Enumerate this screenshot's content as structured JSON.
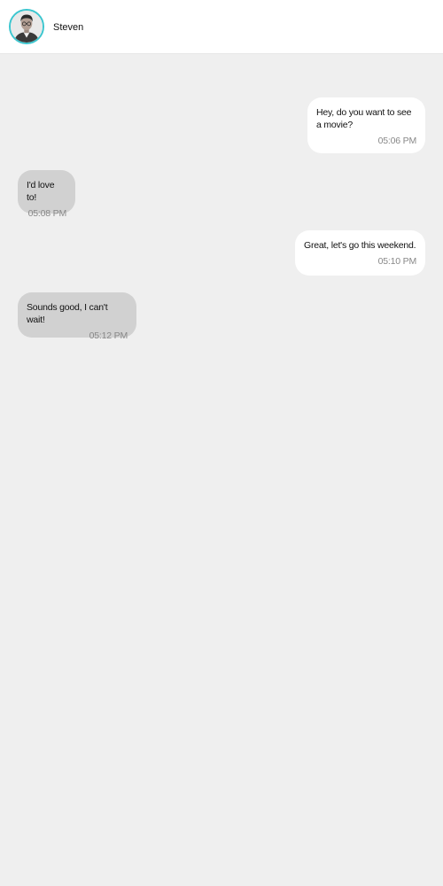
{
  "header": {
    "contact_name": "Steven"
  },
  "messages": [
    {
      "direction": "sent",
      "text": "Hey, do you want to see a movie?",
      "time": "05:06 PM"
    },
    {
      "direction": "received",
      "text": "I'd love to!",
      "time": "05:08 PM"
    },
    {
      "direction": "sent",
      "text": "Great, let's go this weekend.",
      "time": "05:10 PM"
    },
    {
      "direction": "received",
      "text": "Sounds good, I can't wait!",
      "time": "05:12 PM"
    }
  ],
  "colors": {
    "background": "#efefef",
    "header": "#ffffff",
    "sent_bubble": "#ffffff",
    "received_bubble": "#d1d1d1",
    "avatar_ring": "#3cc6cf",
    "timestamp": "#888888"
  }
}
